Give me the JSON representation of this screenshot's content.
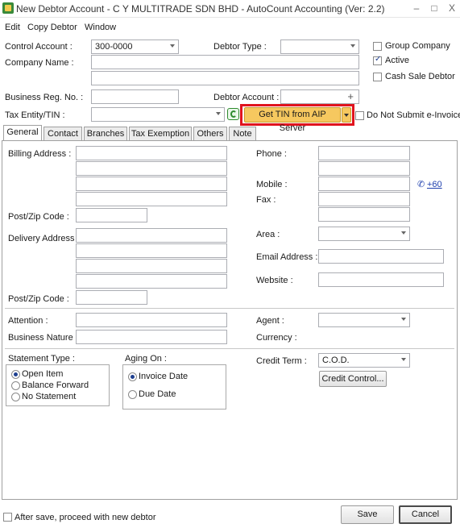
{
  "window": {
    "title": "New Debtor Account - C Y MULTITRADE SDN BHD - AutoCount Accounting (Ver: 2.2)",
    "minimize": "–",
    "maximize": "□",
    "close": "X"
  },
  "menu": [
    "Edit",
    "Copy Debtor",
    "Window"
  ],
  "header": {
    "control_account_label": "Control Account :",
    "control_account_value": "300-0000",
    "debtor_type_label": "Debtor Type :",
    "company_name_label": "Company Name :",
    "business_reg_label": "Business Reg. No. :",
    "debtor_account_label": "Debtor Account :",
    "plus": "+",
    "tax_entity_label": "Tax Entity/TIN :",
    "get_tin_button": "Get TIN from AIP Server",
    "do_not_submit_label": "Do Not Submit e-Invoice",
    "group_company_label": "Group Company",
    "active_label": "Active",
    "cash_sale_label": "Cash Sale Debtor"
  },
  "tabs": [
    "General",
    "Contact",
    "Branches",
    "Tax Exemption",
    "Others",
    "Note"
  ],
  "general": {
    "billing_address_label": "Billing Address :",
    "post_zip_label": "Post/Zip Code :",
    "delivery_address_label": "Delivery Address :",
    "post_zip_label_2": "Post/Zip Code :",
    "phone_label": "Phone :",
    "mobile_label": "Mobile :",
    "mobile_link": "+60",
    "fax_label": "Fax :",
    "area_label": "Area :",
    "email_label": "Email  Address :",
    "website_label": "Website :",
    "attention_label": "Attention :",
    "business_nature_label": "Business Nature :",
    "agent_label": "Agent :",
    "currency_label": "Currency :",
    "statement_type_label": "Statement Type :",
    "statement_options": [
      "Open Item",
      "Balance Forward",
      "No Statement"
    ],
    "aging_on_label": "Aging On :",
    "aging_options": [
      "Invoice Date",
      "Due Date"
    ],
    "credit_term_label": "Credit Term :",
    "credit_term_value": "C.O.D.",
    "credit_control_button": "Credit Control..."
  },
  "footer": {
    "after_save_label": "After save, proceed with new debtor",
    "save_button": "Save",
    "cancel_button": "Cancel"
  },
  "colors": {
    "highlight_button": "#f6c85f",
    "highlight_border": "#e0141e",
    "link": "#1e3fae"
  }
}
